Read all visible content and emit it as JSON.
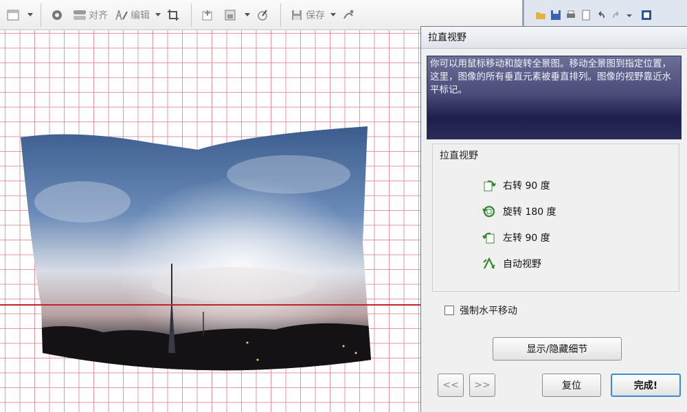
{
  "toolbar": {
    "align_label": "对齐",
    "edit_label": "编辑",
    "save_label": "保存"
  },
  "dialog": {
    "title": "拉直视野",
    "description": "你可以用鼠标移动和旋转全景图。移动全景图到指定位置，这里，图像的所有垂直元素被垂直排列。图像的视野靠近水平标记。",
    "group_title": "拉直视野",
    "actions": [
      {
        "label": "右转 90 度",
        "icon": "rotate-right-icon"
      },
      {
        "label": "旋转 180 度",
        "icon": "rotate-180-icon"
      },
      {
        "label": "左转 90 度",
        "icon": "rotate-left-icon"
      },
      {
        "label": "自动视野",
        "icon": "auto-level-icon"
      }
    ],
    "force_horizontal_label": "强制水平移动",
    "force_horizontal_checked": false,
    "toggle_details_label": "显示/隐藏细节",
    "prev_label": "<<",
    "next_label": ">>",
    "reset_label": "复位",
    "finish_label": "完成!"
  },
  "colors": {
    "grid": "#d67882",
    "horizon": "#c2202d",
    "description_bg": "#2a2b58",
    "finish_border": "#3c8ad3"
  }
}
